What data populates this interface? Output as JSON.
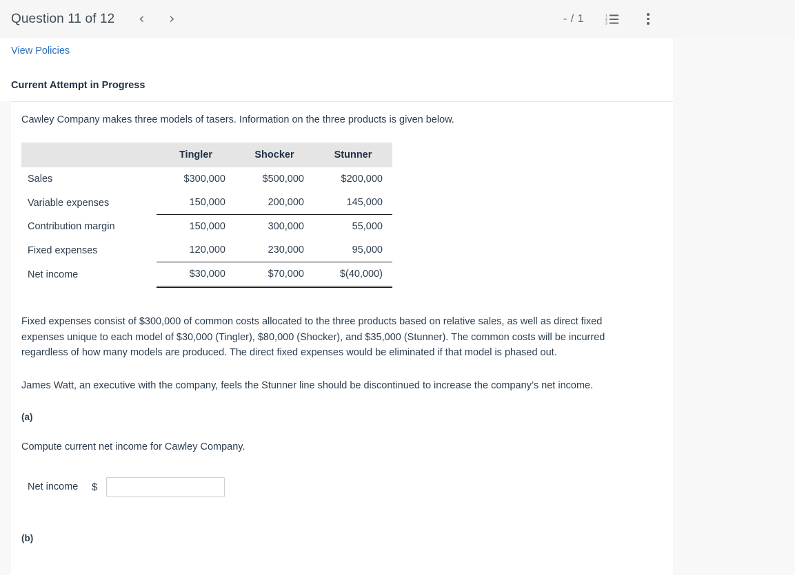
{
  "topbar": {
    "question_title": "Question 11 of 12",
    "prev_arrow": "‹",
    "next_arrow": "›",
    "score": "- / 1",
    "list_icon_name": "numbered-list-icon",
    "menu_icon_name": "more-options-icon"
  },
  "header": {
    "view_policies": "View Policies",
    "attempt_status": "Current Attempt in Progress"
  },
  "question": {
    "intro": "Cawley Company makes three models of tasers. Information on the three products is given below.",
    "paragraph1": "Fixed expenses consist of $300,000 of common costs allocated to the three products based on relative sales, as well as direct fixed expenses unique to each model of $30,000 (Tingler), $80,000 (Shocker), and $35,000 (Stunner). The common costs will be incurred regardless of how many models are produced. The direct fixed expenses would be eliminated if that model is phased out.",
    "paragraph2": "James Watt, an executive with the company, feels the Stunner line should be discontinued to increase the company’s net income."
  },
  "table": {
    "corner": "",
    "columns": [
      "Tingler",
      "Shocker",
      "Stunner"
    ],
    "rows": [
      {
        "label": "Sales",
        "values": [
          "$300,000",
          "$500,000",
          "$200,000"
        ],
        "rule": "none"
      },
      {
        "label": "Variable expenses",
        "values": [
          "150,000",
          "200,000",
          "145,000"
        ],
        "rule": "single"
      },
      {
        "label": "Contribution margin",
        "values": [
          "150,000",
          "300,000",
          "55,000"
        ],
        "rule": "none"
      },
      {
        "label": "Fixed expenses",
        "values": [
          "120,000",
          "230,000",
          "95,000"
        ],
        "rule": "single"
      },
      {
        "label": "Net income",
        "values": [
          "$30,000",
          "$70,000",
          "$(40,000)"
        ],
        "rule": "double"
      }
    ]
  },
  "part_a": {
    "label": "(a)",
    "prompt": "Compute current net income for Cawley Company.",
    "answer_label": "Net income",
    "currency_symbol": "$",
    "answer_value": "",
    "answer_placeholder": ""
  },
  "part_b": {
    "label": "(b)"
  }
}
